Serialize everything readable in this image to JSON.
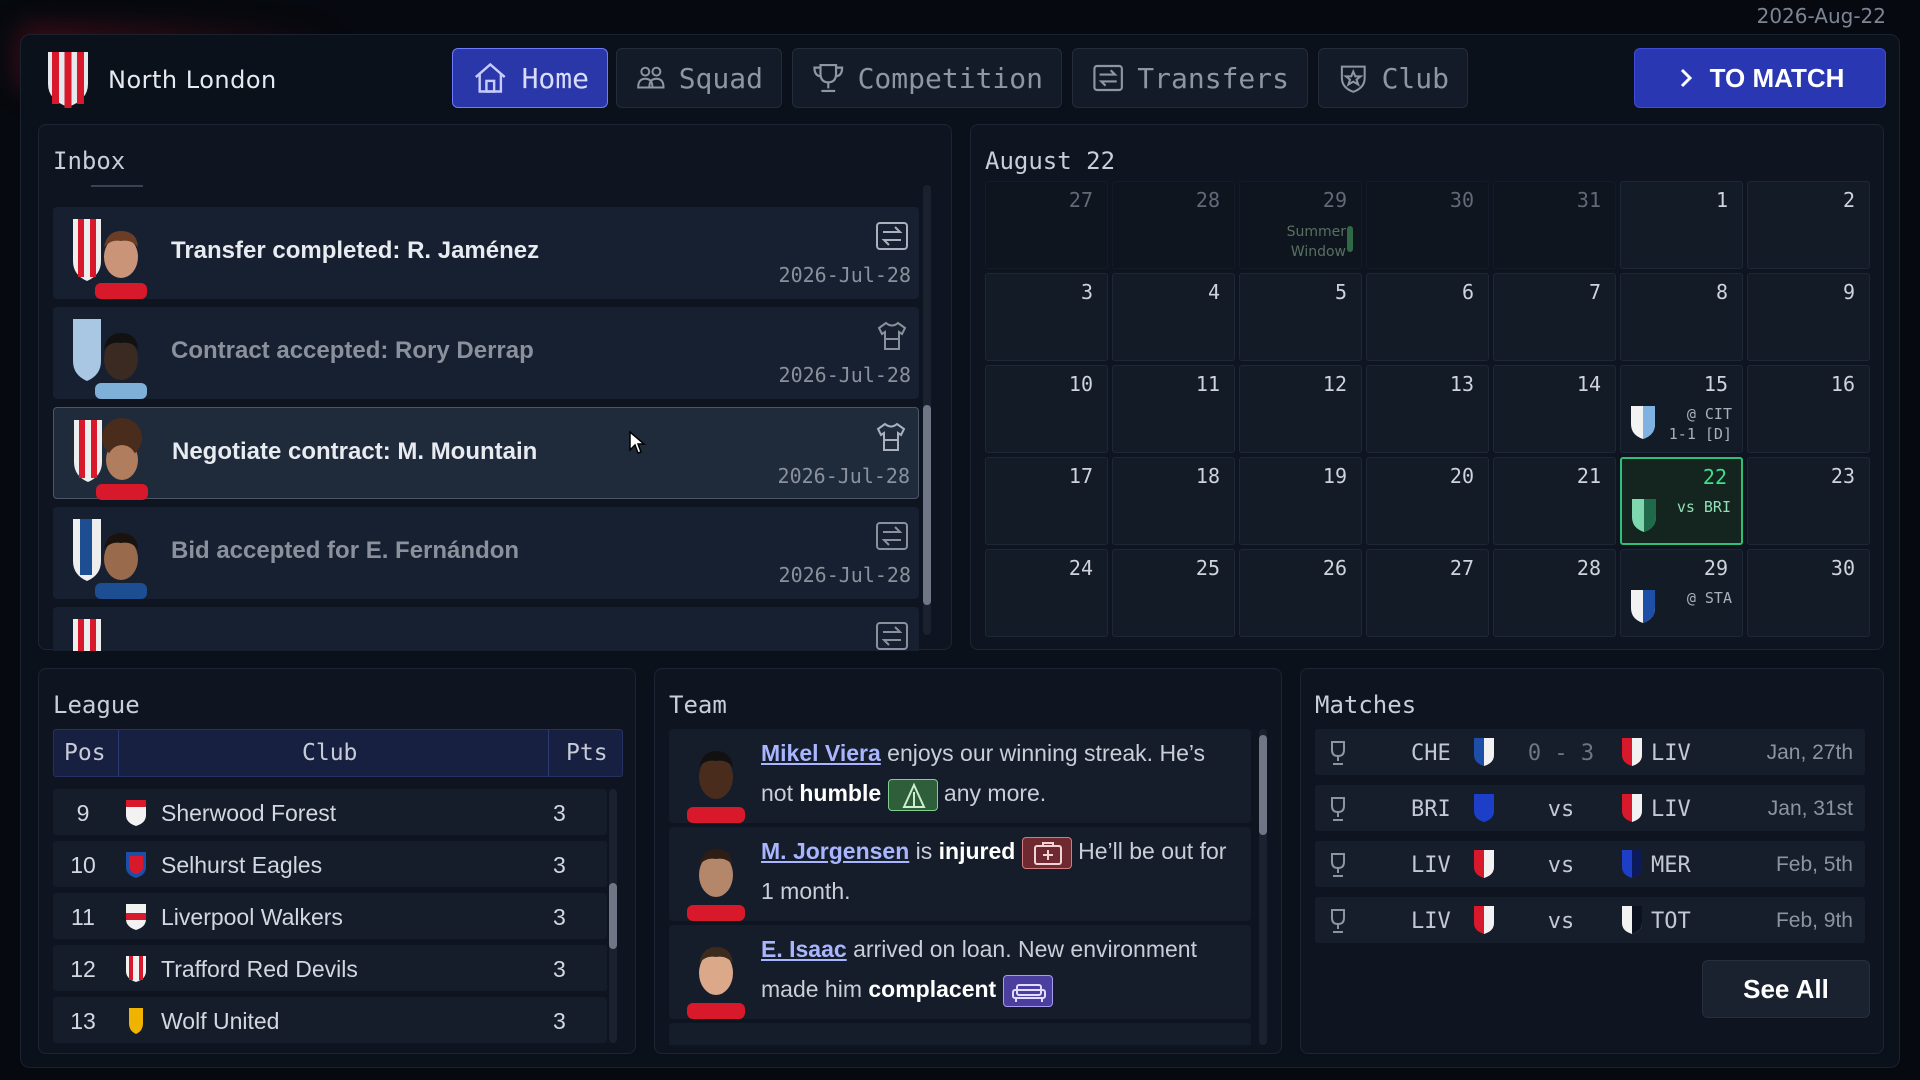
{
  "top_date": "2026-Aug-22",
  "club": {
    "name": "North London"
  },
  "nav": {
    "tabs": [
      {
        "label": "Home",
        "icon": "home-icon"
      },
      {
        "label": "Squad",
        "icon": "people-icon"
      },
      {
        "label": "Competition",
        "icon": "trophy-icon"
      },
      {
        "label": "Transfers",
        "icon": "transfer-icon"
      },
      {
        "label": "Club",
        "icon": "shield-star-icon"
      }
    ],
    "to_match": "TO MATCH"
  },
  "inbox": {
    "title": "Inbox",
    "items": [
      {
        "title": "Transfer completed: R. Jaménez",
        "date": "2026-Jul-28",
        "icon": "transfer-icon"
      },
      {
        "title": "Contract accepted: Rory Derrap",
        "date": "2026-Jul-28",
        "icon": "jersey-icon"
      },
      {
        "title": "Negotiate contract: M. Mountain",
        "date": "2026-Jul-28",
        "icon": "jersey-icon"
      },
      {
        "title": "Bid accepted for E. Fernándon",
        "date": "2026-Jul-28",
        "icon": "transfer-icon"
      }
    ]
  },
  "calendar": {
    "month_label": "August 22",
    "summer_window": "Summer Window",
    "days": [
      "27",
      "28",
      "29",
      "30",
      "31",
      "1",
      "2",
      "3",
      "4",
      "5",
      "6",
      "7",
      "8",
      "9",
      "10",
      "11",
      "12",
      "13",
      "14",
      "15",
      "16",
      "17",
      "18",
      "19",
      "20",
      "21",
      "22",
      "23",
      "24",
      "25",
      "26",
      "27",
      "28",
      "29",
      "30"
    ],
    "events": {
      "15": [
        "@ CIT",
        "1-1 [D]"
      ],
      "22": [
        "vs BRI"
      ],
      "29": [
        "@ STA"
      ]
    }
  },
  "league": {
    "title": "League",
    "headers": {
      "pos": "Pos",
      "club": "Club",
      "pts": "Pts"
    },
    "rows": [
      {
        "pos": "9",
        "club": "Sherwood Forest",
        "pts": "3"
      },
      {
        "pos": "10",
        "club": "Selhurst Eagles",
        "pts": "3"
      },
      {
        "pos": "11",
        "club": "Liverpool Walkers",
        "pts": "3"
      },
      {
        "pos": "12",
        "club": "Trafford Red Devils",
        "pts": "3"
      },
      {
        "pos": "13",
        "club": "Wolf United",
        "pts": "3"
      }
    ]
  },
  "team": {
    "title": "Team",
    "items": [
      {
        "name": "Mikel Viera",
        "t1": " enjoys our winning streak. He’s not ",
        "bold": "humble",
        "t2": " any more."
      },
      {
        "name": "M. Jorgensen",
        "t1": " is ",
        "bold": "injured",
        "t2": " He’ll be out for 1 month."
      },
      {
        "name": "E. Isaac",
        "t1": " arrived on loan. New environment made him ",
        "bold": "complacent",
        "t2": ""
      }
    ]
  },
  "matches": {
    "title": "Matches",
    "rows": [
      {
        "home": "CHE",
        "mid": "0 - 3",
        "away": "LIV",
        "date": "Jan, 27th"
      },
      {
        "home": "BRI",
        "mid": "vs",
        "away": "LIV",
        "date": "Jan, 31st"
      },
      {
        "home": "LIV",
        "mid": "vs",
        "away": "MER",
        "date": "Feb, 5th"
      },
      {
        "home": "LIV",
        "mid": "vs",
        "away": "TOT",
        "date": "Feb, 9th"
      }
    ],
    "see_all": "See All"
  }
}
